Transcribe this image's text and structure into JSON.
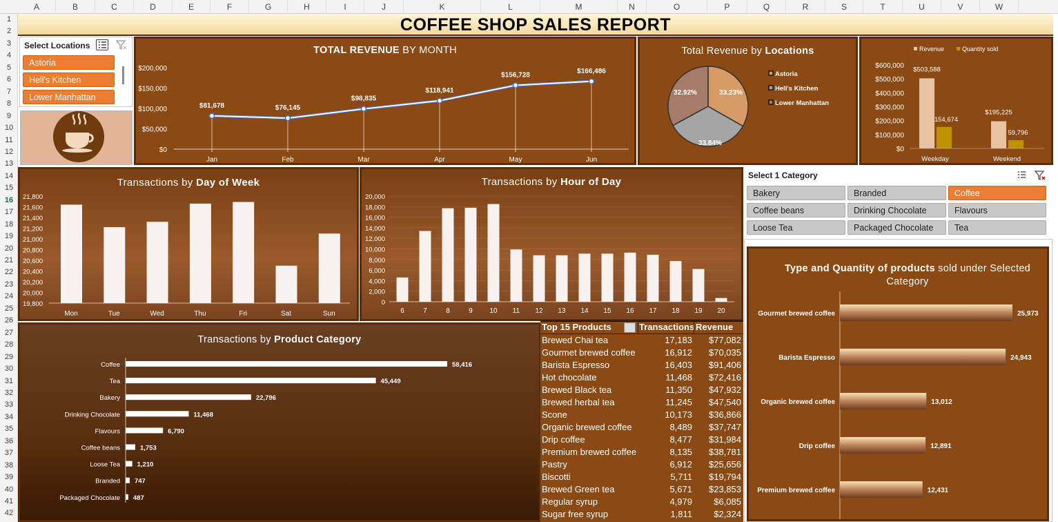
{
  "spreadsheet": {
    "columns": [
      "A",
      "B",
      "C",
      "D",
      "E",
      "F",
      "G",
      "H",
      "I",
      "J",
      "K",
      "L",
      "M",
      "N",
      "O",
      "P",
      "Q",
      "R",
      "S",
      "T",
      "U",
      "V",
      "W"
    ],
    "rows": [
      "1",
      "2",
      "3",
      "4",
      "5",
      "6",
      "7",
      "8",
      "9",
      "10",
      "11",
      "12",
      "13",
      "14",
      "15",
      "16",
      "17",
      "18",
      "19",
      "20",
      "21",
      "22",
      "23",
      "24",
      "25",
      "26",
      "27",
      "28",
      "29",
      "30",
      "31",
      "32",
      "33",
      "34",
      "35",
      "36",
      "37",
      "38",
      "39",
      "40",
      "41",
      "42"
    ],
    "selected_row": "16"
  },
  "report_title": "COFFEE SHOP SALES REPORT",
  "location_slicer": {
    "header": "Select Locations",
    "items": [
      {
        "label": "Astoria",
        "selected": true
      },
      {
        "label": "Hell's Kitchen",
        "selected": true
      },
      {
        "label": "Lower Manhattan",
        "selected": true
      }
    ]
  },
  "category_slicer": {
    "header": "Select 1 Category",
    "items": [
      {
        "label": "Bakery",
        "selected": false
      },
      {
        "label": "Branded",
        "selected": false
      },
      {
        "label": "Coffee",
        "selected": true
      },
      {
        "label": "Coffee beans",
        "selected": false
      },
      {
        "label": "Drinking Chocolate",
        "selected": false
      },
      {
        "label": "Flavours",
        "selected": false
      },
      {
        "label": "Loose Tea",
        "selected": false
      },
      {
        "label": "Packaged Chocolate",
        "selected": false
      },
      {
        "label": "Tea",
        "selected": false
      }
    ]
  },
  "icons": {
    "multi_select": "multi-select-icon",
    "clear_filter": "clear-filter-icon",
    "logo": "coffee-cup-icon"
  },
  "colors": {
    "panel": "#8b4a14",
    "panel_border": "#5b2c0a",
    "accent_orange": "#ed7d31",
    "line": "#4472c4",
    "revenue_bar": "#e8c3a2",
    "quantity_bar": "#bf9000"
  },
  "chart_data": [
    {
      "id": "revenue_by_month",
      "type": "line",
      "title_bold": "TOTAL REVENUE",
      "title_rest": " BY MONTH",
      "categories": [
        "Jan",
        "Feb",
        "Mar",
        "Apr",
        "May",
        "Jun"
      ],
      "values": [
        81678,
        76145,
        98835,
        118941,
        156728,
        166486
      ],
      "labels": [
        "$81,678",
        "$76,145",
        "$98,835",
        "$118,941",
        "$156,728",
        "$166,486"
      ],
      "yticks": [
        "$0",
        "$50,000",
        "$100,000",
        "$150,000",
        "$200,000"
      ],
      "ylim": [
        0,
        200000
      ],
      "grid": false
    },
    {
      "id": "revenue_by_location",
      "type": "pie",
      "title_rest": "Total Revenue by ",
      "title_bold": "Locations",
      "categories": [
        "Astoria",
        "Hell's Kitchen",
        "Lower Manhattan"
      ],
      "values": [
        33.23,
        33.84,
        32.92
      ],
      "labels": [
        "33.23%",
        "33.84%",
        "32.92%"
      ],
      "slice_colors": [
        "#d89a66",
        "#a5a5a5",
        "#a57c6a"
      ],
      "legend": "right"
    },
    {
      "id": "weekday_weekend",
      "type": "bar",
      "categories": [
        "Weekday",
        "Weekend"
      ],
      "series": [
        {
          "name": "Revenue",
          "values": [
            503588,
            195225
          ],
          "labels": [
            "$503,588",
            "$195,225"
          ]
        },
        {
          "name": "Quantity sold",
          "values": [
            154674,
            59796
          ],
          "labels": [
            "154,674",
            "59,796"
          ]
        }
      ],
      "yticks": [
        "$0",
        "$100,000",
        "$200,000",
        "$300,000",
        "$400,000",
        "$500,000",
        "$600,000"
      ],
      "ylim": [
        0,
        600000
      ],
      "legend": "top"
    },
    {
      "id": "transactions_by_day",
      "type": "bar",
      "title_rest": "Transactions by ",
      "title_bold": "Day of Week",
      "categories": [
        "Mon",
        "Tue",
        "Wed",
        "Thu",
        "Fri",
        "Sat",
        "Sun"
      ],
      "values": [
        21640,
        21220,
        21320,
        21660,
        21690,
        20500,
        21100
      ],
      "yticks": [
        "19,800",
        "20,000",
        "20,200",
        "20,400",
        "20,600",
        "20,800",
        "21,000",
        "21,200",
        "21,400",
        "21,600",
        "21,800"
      ],
      "ylim": [
        19800,
        21800
      ]
    },
    {
      "id": "transactions_by_hour",
      "type": "bar",
      "title_rest": "Transactions by ",
      "title_bold": "Hour of Day",
      "categories": [
        "6",
        "7",
        "8",
        "9",
        "10",
        "11",
        "12",
        "13",
        "14",
        "15",
        "16",
        "17",
        "18",
        "19",
        "20"
      ],
      "values": [
        4600,
        13400,
        17700,
        17800,
        18500,
        9900,
        8800,
        8800,
        9100,
        9100,
        9300,
        8900,
        7700,
        6200,
        700
      ],
      "yticks": [
        "0",
        "2,000",
        "4,000",
        "6,000",
        "8,000",
        "10,000",
        "12,000",
        "14,000",
        "16,000",
        "18,000",
        "20,000"
      ],
      "ylim": [
        0,
        20000
      ],
      "grid": true
    },
    {
      "id": "transactions_by_category",
      "type": "bar",
      "orientation": "horizontal",
      "title_rest": "Transactions by ",
      "title_bold": "Product Category",
      "categories": [
        "Coffee",
        "Tea",
        "Bakery",
        "Drinking Chocolate",
        "Flavours",
        "Coffee beans",
        "Loose Tea",
        "Branded",
        "Packaged Chocolate"
      ],
      "values": [
        58416,
        45449,
        22796,
        11468,
        6790,
        1753,
        1210,
        747,
        487
      ],
      "labels": [
        "58,416",
        "45,449",
        "22,796",
        "11,468",
        "6,790",
        "1,753",
        "1,210",
        "747",
        "487"
      ]
    },
    {
      "id": "products_in_category",
      "type": "bar",
      "orientation": "horizontal",
      "title_bold": "Type and Quantity of products",
      "title_rest": " sold under Selected Category",
      "categories": [
        "Gourmet brewed coffee",
        "Barista Espresso",
        "Organic brewed coffee",
        "Drip coffee",
        "Premium brewed coffee"
      ],
      "values": [
        25973,
        24943,
        13012,
        12891,
        12431
      ],
      "labels": [
        "25,973",
        "24,943",
        "13,012",
        "12,891",
        "12,431"
      ]
    },
    {
      "id": "top_15_products",
      "type": "table",
      "columns": [
        "Top 15 Products",
        "Transactions",
        "Revenue"
      ],
      "rows": [
        [
          "Brewed Chai tea",
          "17,183",
          "$77,082"
        ],
        [
          "Gourmet brewed coffee",
          "16,912",
          "$70,035"
        ],
        [
          "Barista Espresso",
          "16,403",
          "$91,406"
        ],
        [
          "Hot chocolate",
          "11,468",
          "$72,416"
        ],
        [
          "Brewed Black tea",
          "11,350",
          "$47,932"
        ],
        [
          "Brewed herbal tea",
          "11,245",
          "$47,540"
        ],
        [
          "Scone",
          "10,173",
          "$36,866"
        ],
        [
          "Organic brewed coffee",
          "8,489",
          "$37,747"
        ],
        [
          "Drip coffee",
          "8,477",
          "$31,984"
        ],
        [
          "Premium brewed coffee",
          "8,135",
          "$38,781"
        ],
        [
          "Pastry",
          "6,912",
          "$25,656"
        ],
        [
          "Biscotti",
          "5,711",
          "$19,794"
        ],
        [
          "Brewed Green tea",
          "5,671",
          "$23,853"
        ],
        [
          "Regular syrup",
          "4,979",
          "$6,085"
        ],
        [
          "Sugar free syrup",
          "1,811",
          "$2,324"
        ]
      ]
    }
  ]
}
